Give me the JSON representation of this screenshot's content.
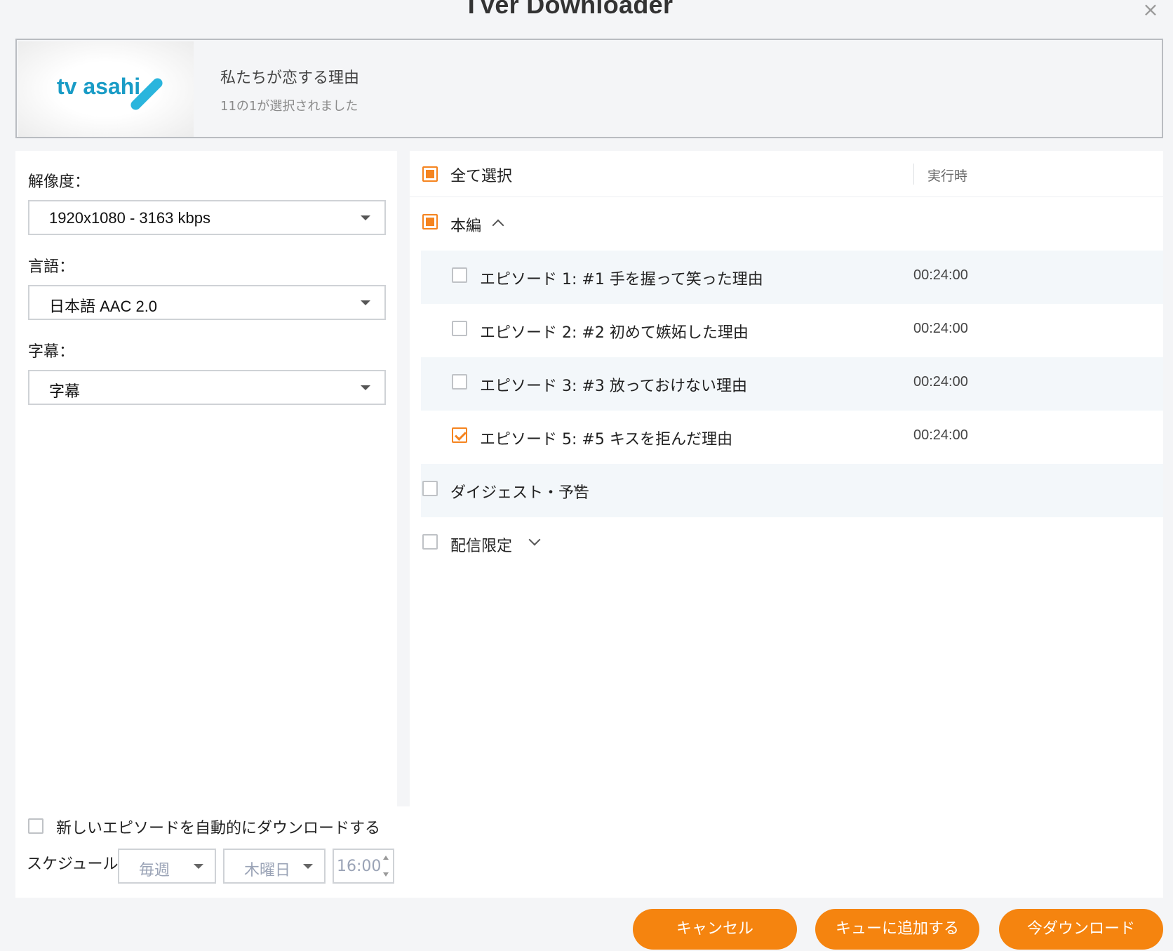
{
  "window": {
    "title": "TVer Downloader",
    "close_glyph": "×"
  },
  "show": {
    "logo_text": "tv asahi",
    "name": "私たちが恋する理由",
    "selection_status": "11の1が選択されました"
  },
  "options": {
    "resolution_label": "解像度：",
    "resolution_value": "1920x1080 - 3163 kbps",
    "language_label": "言語：",
    "language_value": "日本語 AAC 2.0",
    "subtitle_label": "字幕：",
    "subtitle_value": "字幕"
  },
  "list": {
    "select_all_label": "全て選択",
    "duration_header": "実行時",
    "groups": [
      {
        "label": "本編",
        "expanded": true
      },
      {
        "label": "ダイジェスト・予告",
        "expanded": false
      },
      {
        "label": "配信限定",
        "expanded": false
      }
    ],
    "episodes": [
      {
        "title": "エピソード 1: #1 手を握って笑った理由",
        "duration": "00:24:00",
        "checked": false
      },
      {
        "title": "エピソード 2: #2 初めて嫉妬した理由",
        "duration": "00:24:00",
        "checked": false
      },
      {
        "title": "エピソード 3: #3 放っておけない理由",
        "duration": "00:24:00",
        "checked": false
      },
      {
        "title": "エピソード 5: #5 キスを拒んだ理由",
        "duration": "00:24:00",
        "checked": true
      }
    ]
  },
  "auto_download": {
    "label": "新しいエピソードを自動的にダウンロードする",
    "checked": false,
    "schedule_label": "スケジュール:",
    "frequency": "毎週",
    "day": "木曜日",
    "time": "16:00"
  },
  "buttons": {
    "cancel": "キャンセル",
    "add_queue": "キューに追加する",
    "download_now": "今ダウンロード"
  },
  "colors": {
    "accent": "#f5840f",
    "logo": "#1a9cc6"
  }
}
